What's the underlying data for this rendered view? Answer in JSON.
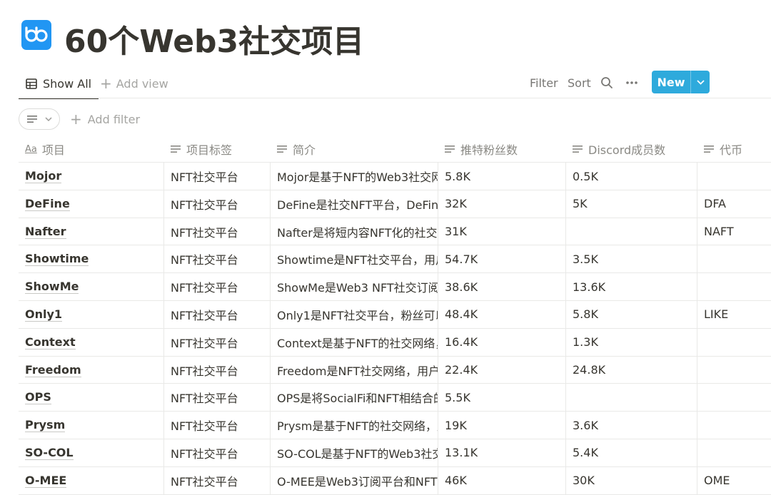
{
  "page": {
    "title": "60个Web3社交项目",
    "logo_icon": "bb-logo-icon",
    "accent": "#2196f3"
  },
  "viewbar": {
    "active_tab": "Show All",
    "add_view": "Add view",
    "filter": "Filter",
    "sort": "Sort",
    "new": "New",
    "new_color": "#2eaadc"
  },
  "filterbar": {
    "add_filter": "Add filter"
  },
  "table": {
    "columns": [
      {
        "label": "项目",
        "icon": "title-property-icon"
      },
      {
        "label": "项目标签",
        "icon": "text-property-icon"
      },
      {
        "label": "简介",
        "icon": "text-property-icon"
      },
      {
        "label": "推特粉丝数",
        "icon": "text-property-icon"
      },
      {
        "label": "Discord成员数",
        "icon": "text-property-icon"
      },
      {
        "label": "代币",
        "icon": "text-property-icon"
      }
    ],
    "rows": [
      {
        "name": "Mojor",
        "tag": "NFT社交平台",
        "desc": "Mojor是基于NFT的Web3社交网",
        "twitter": "5.8K",
        "discord": "0.5K",
        "token": ""
      },
      {
        "name": "DeFine",
        "tag": "NFT社交平台",
        "desc": "DeFine是社交NFT平台，DeFine",
        "twitter": "32K",
        "discord": "5K",
        "token": "DFA"
      },
      {
        "name": "Nafter",
        "tag": "NFT社交平台",
        "desc": "Nafter是将短内容NFT化的社交",
        "twitter": "31K",
        "discord": "",
        "token": "NAFT"
      },
      {
        "name": "Showtime",
        "tag": "NFT社交平台",
        "desc": "Showtime是NFT社交平台，用户",
        "twitter": "54.7K",
        "discord": "3.5K",
        "token": ""
      },
      {
        "name": "ShowMe",
        "tag": "NFT社交平台",
        "desc": "ShowMe是Web3 NFT社交订阅平",
        "twitter": "38.6K",
        "discord": "13.6K",
        "token": ""
      },
      {
        "name": "Only1",
        "tag": "NFT社交平台",
        "desc": "Only1是NFT社交平台，粉丝可以",
        "twitter": "48.4K",
        "discord": "5.8K",
        "token": "LIKE"
      },
      {
        "name": "Context",
        "tag": "NFT社交平台",
        "desc": "Context是基于NFT的社交网络，",
        "twitter": "16.4K",
        "discord": "1.3K",
        "token": ""
      },
      {
        "name": "Freedom",
        "tag": "NFT社交平台",
        "desc": "Freedom是NFT社交网络，用户",
        "twitter": "22.4K",
        "discord": "24.8K",
        "token": ""
      },
      {
        "name": "OPS",
        "tag": "NFT社交平台",
        "desc": "OPS是将SocialFi和NFT相结合的",
        "twitter": "5.5K",
        "discord": "",
        "token": ""
      },
      {
        "name": "Prysm",
        "tag": "NFT社交平台",
        "desc": "Prysm是基于NFT的社交网络，用",
        "twitter": "19K",
        "discord": "3.6K",
        "token": ""
      },
      {
        "name": "SO-COL",
        "tag": "NFT社交平台",
        "desc": "SO-COL是基于NFT的Web3社交",
        "twitter": "13.1K",
        "discord": "5.4K",
        "token": ""
      },
      {
        "name": "O-MEE",
        "tag": "NFT社交平台",
        "desc": "O-MEE是Web3订阅平台和NFT发",
        "twitter": "46K",
        "discord": "30K",
        "token": "OME"
      }
    ]
  }
}
